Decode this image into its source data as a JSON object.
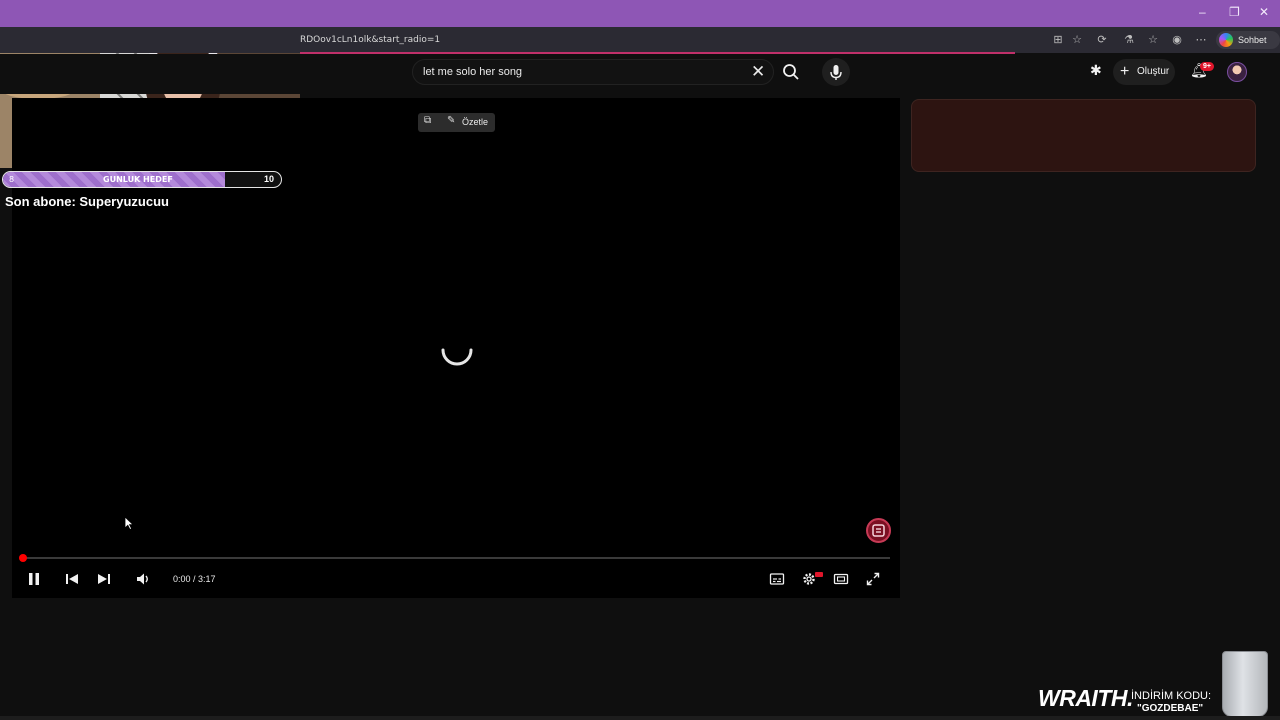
{
  "browser": {
    "url_fragment": "RDOov1cLn1olk&start_radio=1",
    "chat_button_label": "Sohbet et",
    "window_controls": [
      "–",
      "❐",
      "✕"
    ]
  },
  "youtube": {
    "search": {
      "value": "let me solo her song"
    },
    "create_button_label": "Oluştur",
    "notification_badge": "9+",
    "player": {
      "summarize_label": "Özetle",
      "time_current": "0:00",
      "time_separator": " / ",
      "time_total": "3:17",
      "progress_fraction": 0.003
    }
  },
  "overlay": {
    "goal": {
      "label": "GUNLUK HEDEF",
      "current": "8",
      "target": "10",
      "progress_fraction": 0.8
    },
    "last_sub": "Son abone: Superyuzucuu",
    "sponsor": {
      "brand": "WRAITH.",
      "discount_label": "İNDİRİM KODU:",
      "code": "\"GOZDEBAE\""
    }
  },
  "colors": {
    "titlebar": "#8e56b5",
    "accent_red": "#ff0000",
    "goal_fill": "#b48adb",
    "side_card": "#2d1411"
  },
  "icons": [
    "search-icon",
    "close-icon",
    "mic-icon",
    "add-video-icon",
    "plus-icon",
    "bell-icon",
    "pause-icon",
    "previous-icon",
    "next-icon",
    "volume-icon",
    "subtitles-icon",
    "settings-icon",
    "theater-icon",
    "fullscreen-icon",
    "music-icon",
    "loading-spinner-icon"
  ]
}
